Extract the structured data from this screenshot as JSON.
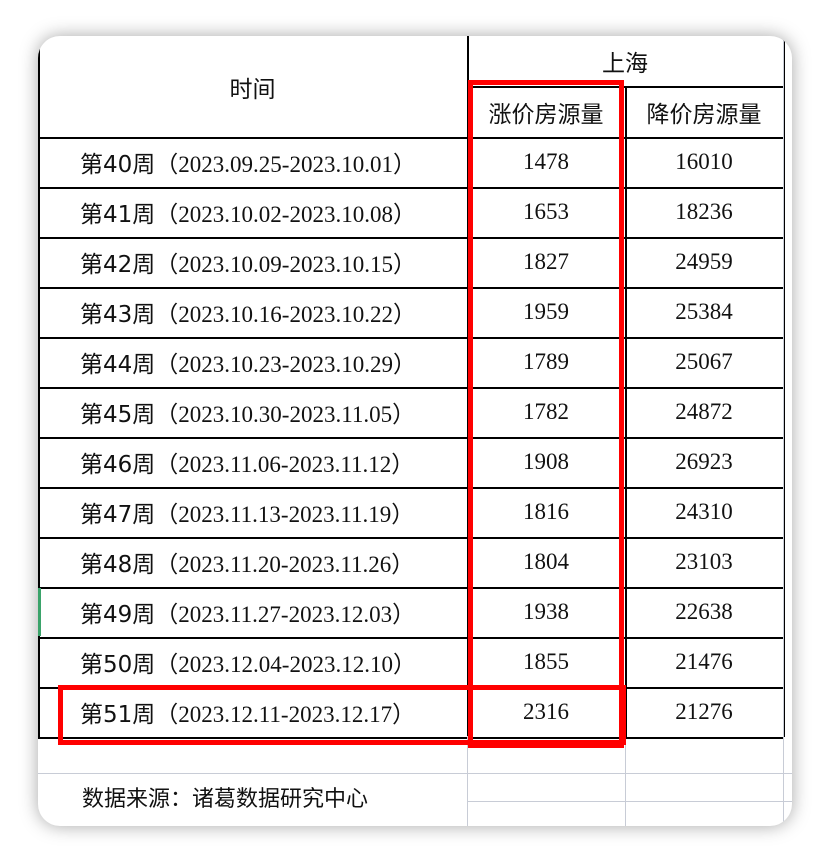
{
  "header": {
    "time_label": "时间",
    "region_label": "上海",
    "up_label": "涨价房源量",
    "down_label": "降价房源量"
  },
  "rows": [
    {
      "week": "第40周",
      "range": "（2023.09.25-2023.10.01）",
      "up": "1478",
      "down": "16010"
    },
    {
      "week": "第41周",
      "range": "（2023.10.02-2023.10.08）",
      "up": "1653",
      "down": "18236"
    },
    {
      "week": "第42周",
      "range": "（2023.10.09-2023.10.15）",
      "up": "1827",
      "down": "24959"
    },
    {
      "week": "第43周",
      "range": "（2023.10.16-2023.10.22）",
      "up": "1959",
      "down": "25384"
    },
    {
      "week": "第44周",
      "range": "（2023.10.23-2023.10.29）",
      "up": "1789",
      "down": "25067"
    },
    {
      "week": "第45周",
      "range": "（2023.10.30-2023.11.05）",
      "up": "1782",
      "down": "24872"
    },
    {
      "week": "第46周",
      "range": "（2023.11.06-2023.11.12）",
      "up": "1908",
      "down": "26923"
    },
    {
      "week": "第47周",
      "range": "（2023.11.13-2023.11.19）",
      "up": "1816",
      "down": "24310"
    },
    {
      "week": "第48周",
      "range": "（2023.11.20-2023.11.26）",
      "up": "1804",
      "down": "23103"
    },
    {
      "week": "第49周",
      "range": "（2023.11.27-2023.12.03）",
      "up": "1938",
      "down": "22638"
    },
    {
      "week": "第50周",
      "range": "（2023.12.04-2023.12.10）",
      "up": "1855",
      "down": "21476"
    },
    {
      "week": "第51周",
      "range": "（2023.12.11-2023.12.17）",
      "up": "2316",
      "down": "21276"
    }
  ],
  "footer": {
    "source": "数据来源：诸葛数据研究中心"
  },
  "colors": {
    "highlight": "#ff0000",
    "grid": "#c8ccd6",
    "border": "#000000",
    "row_marker_green": "#3aa36a"
  }
}
